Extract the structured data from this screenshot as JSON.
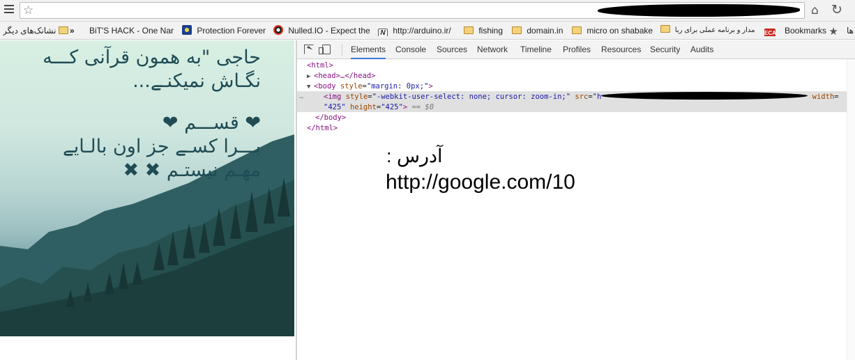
{
  "browser": {
    "menu_icon": "hamburger-icon",
    "star_icon": "star-icon",
    "home_icon": "home-icon",
    "reload_icon": "reload-icon"
  },
  "bookmarks": {
    "other": "نشانک‌های دیگر",
    "overflow": "»",
    "items": [
      "BiT'S HACK - One Nar",
      "Protection Forever",
      "Nulled.IO - Expect the",
      "http://arduino.ir/",
      "fishing",
      "domain.in",
      "micro on shabake",
      "مدار و برنامه عملی برای ربا",
      "Bookmarks",
      "ها"
    ],
    "eca_label": "ECA"
  },
  "page": {
    "poem_lines": [
      "حاجی \"به همون قرآنی کـــه",
      "نگـاش نمیکنـے...",
      "",
      "❤ قســـم ❤",
      "بـــرا کسـے جز اون بالـایے",
      "مهـم نیستـم ✖ ✖"
    ]
  },
  "devtools": {
    "tabs": [
      "Elements",
      "Console",
      "Sources",
      "Network",
      "Timeline",
      "Profiles",
      "Resources",
      "Security",
      "Audits"
    ],
    "active_tab": "Elements",
    "dom": {
      "html_open": "<html>",
      "head": "<head>…</head>",
      "body_open_tag": "<body",
      "body_attr": "style",
      "body_val": "\"margin: 0px;\"",
      "img_tag": "<img",
      "img_style_attr": "style",
      "img_style_val": "\"-webkit-user-select: none; cursor: zoom-in;\"",
      "img_src_attr": "src",
      "img_src_val_start": "\"h",
      "img_width_attr": "width",
      "img_width_val": "\"425\"",
      "img_height_attr": "height",
      "img_height_val": "\"425\"",
      "img_suffix": "== $0",
      "body_close": "</body>",
      "html_close": "</html>"
    }
  },
  "annotation": {
    "label": "آدرس :",
    "url": "http://google.com/10"
  }
}
